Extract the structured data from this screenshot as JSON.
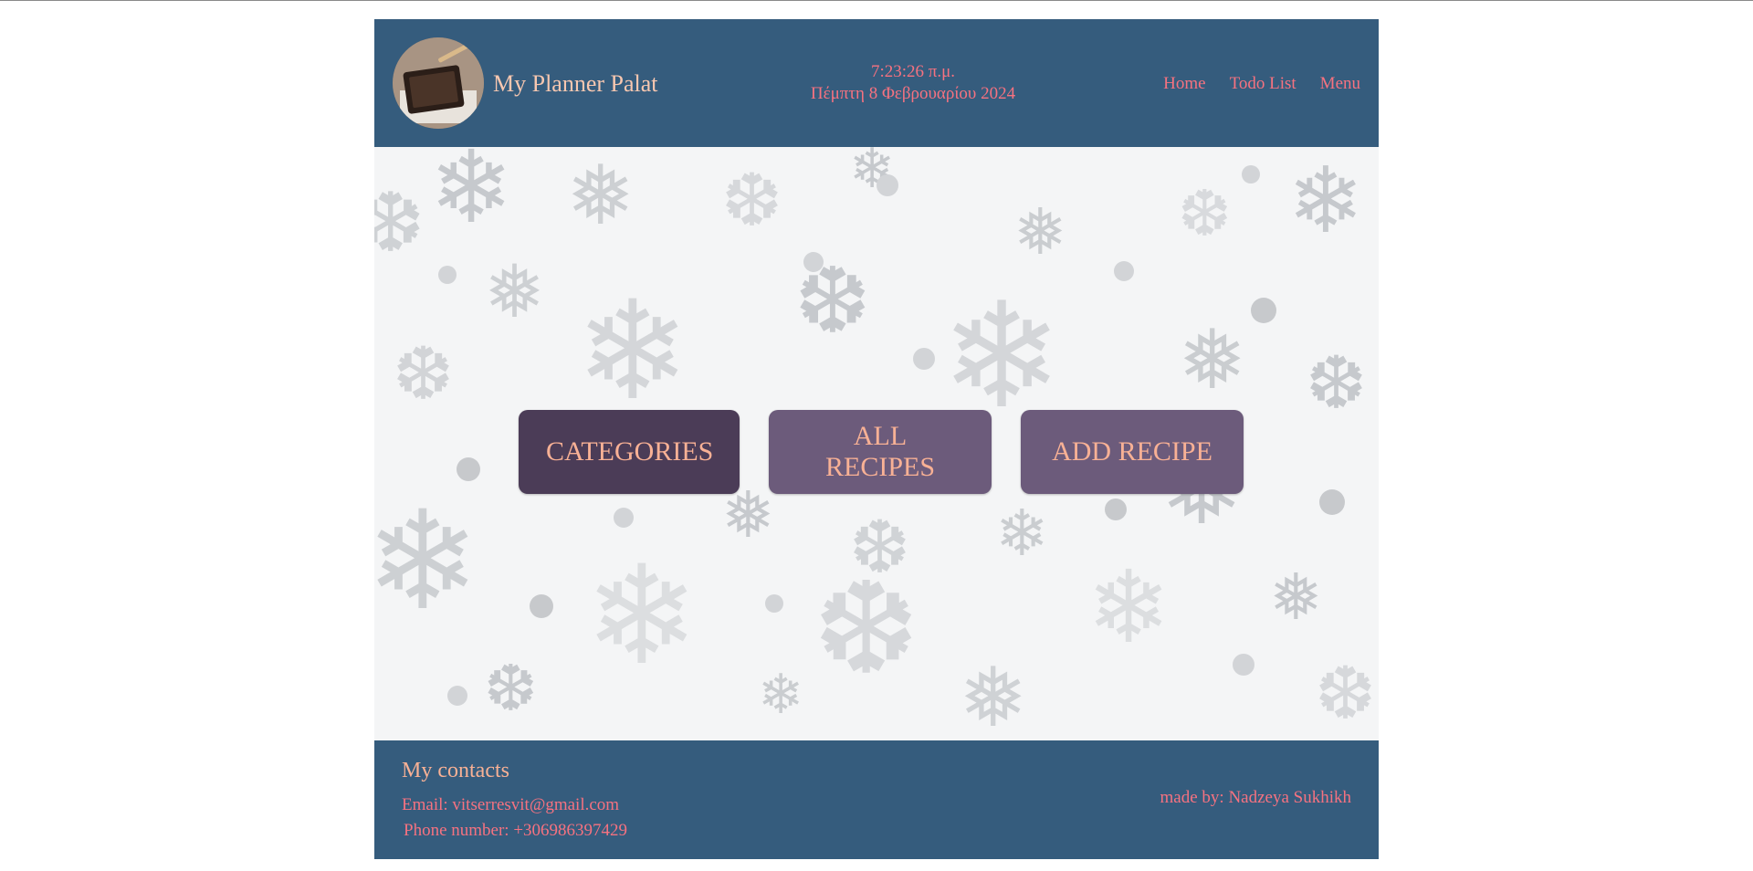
{
  "header": {
    "site_title": "My Planner Palat",
    "time": "7:23:26 π.μ.",
    "date": "Πέμπτη 8 Φεβρουαρίου 2024",
    "nav": {
      "home": "Home",
      "todo": "Todo List",
      "menu": "Menu"
    }
  },
  "main": {
    "buttons": {
      "categories": "CATEGORIES",
      "all_recipes": "ALL RECIPES",
      "add_recipe": "ADD RECIPE"
    }
  },
  "footer": {
    "contacts_title": "My contacts",
    "email": "Email: vitserresvit@gmail.com",
    "phone": "Phone number: +306986397429",
    "made_by": "made by: Nadzeya Sukhikh"
  },
  "colors": {
    "header_bg": "#355c7d",
    "accent_pink": "#f67280",
    "accent_peach": "#f8b195",
    "button_dark": "#4b3c57",
    "button_mid": "#6c5b7b"
  },
  "icons": {
    "logo": "planner-photo",
    "background": "snowflake-pattern"
  }
}
